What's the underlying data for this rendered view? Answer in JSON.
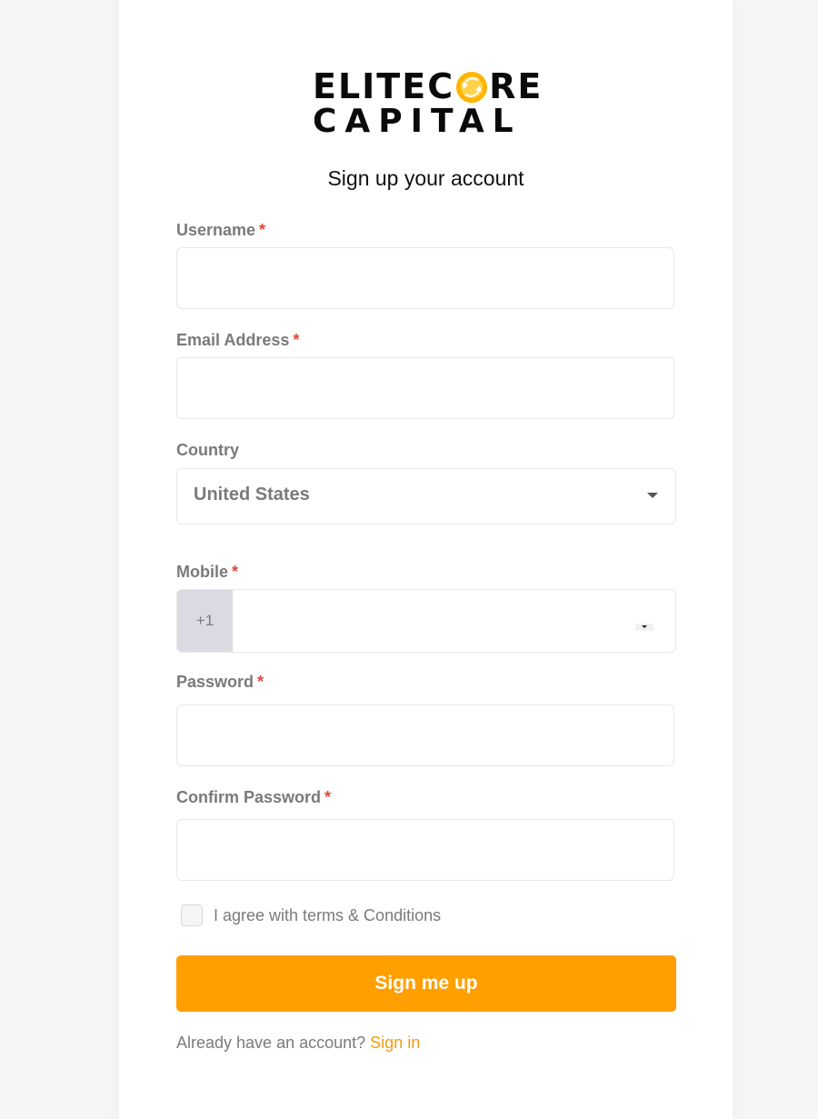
{
  "brand": {
    "line1_before": "ELITEC",
    "line1_after": "RE",
    "line2": "CAPITAL",
    "accent": "#ffb400"
  },
  "heading": "Sign up your account",
  "form": {
    "required_mark": "*",
    "username": {
      "label": "Username",
      "value": ""
    },
    "email": {
      "label": "Email Address",
      "value": ""
    },
    "country": {
      "label": "Country",
      "selected": "United States"
    },
    "mobile": {
      "label": "Mobile",
      "dial_code": "+1",
      "value": ""
    },
    "password": {
      "label": "Password",
      "value": ""
    },
    "confirm_password": {
      "label": "Confirm Password",
      "value": ""
    },
    "terms": {
      "label": "I agree with terms & Conditions",
      "checked": false
    },
    "submit_label": "Sign me up"
  },
  "footer": {
    "prompt": "Already have an account?",
    "link_label": "Sign in"
  },
  "colors": {
    "primary": "#ff9f00",
    "link": "#f39c12",
    "required": "#e0473b"
  },
  "icons": {
    "country_caret": "chevron-down-icon",
    "mobile_flag_caret": "chevron-down-icon",
    "logo_coin": "coin-icon"
  }
}
